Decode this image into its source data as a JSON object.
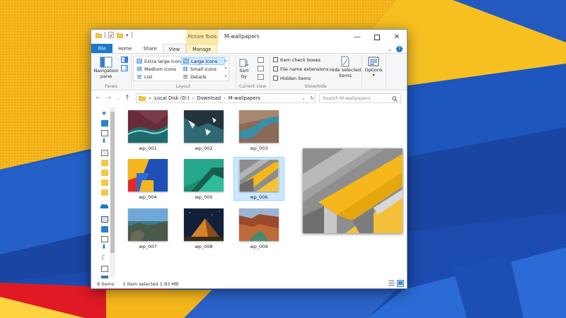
{
  "window": {
    "title": "M-wallpapers",
    "context_tab": "Picture Tools"
  },
  "tabs": [
    {
      "label": "File"
    },
    {
      "label": "Home"
    },
    {
      "label": "Share"
    },
    {
      "label": "View"
    },
    {
      "label": "Manage"
    }
  ],
  "ribbon": {
    "panes": {
      "nav_label": "Navigation pane",
      "nav_line1": "Navigation",
      "nav_line2": "pane",
      "group": "Panes"
    },
    "layout": {
      "items": [
        "Extra large icons",
        "Large icons",
        "Medium icons",
        "Small icons",
        "List",
        "Details"
      ],
      "selected": "Large icons",
      "group": "Layout"
    },
    "current_view": {
      "sort_line1": "Sort",
      "sort_line2": "by",
      "group": "Current view"
    },
    "show_hide": {
      "checkboxes": [
        "Item check boxes",
        "File name extensions",
        "Hidden items"
      ],
      "hide_line1": "Hide selected",
      "hide_line2": "items",
      "group": "Show/hide"
    },
    "options": {
      "label": "Options"
    }
  },
  "address": {
    "prefix": "«",
    "crumbs": [
      "Local Disk (D:)",
      "Download",
      "M-wallpapers"
    ]
  },
  "search": {
    "placeholder": "Search M-wallpapers"
  },
  "files": [
    {
      "name": "wp_001",
      "selected": false
    },
    {
      "name": "wp_002",
      "selected": false
    },
    {
      "name": "wp_003",
      "selected": false
    },
    {
      "name": "wp_004",
      "selected": false
    },
    {
      "name": "wp_005",
      "selected": false
    },
    {
      "name": "wp_006",
      "selected": true
    },
    {
      "name": "wp_007",
      "selected": false
    },
    {
      "name": "wp_008",
      "selected": false
    },
    {
      "name": "wp_009",
      "selected": false
    }
  ],
  "status": {
    "count": "9 items",
    "selection": "1 item selected  1.93 MB"
  },
  "colors": {
    "accent": "#1979ca",
    "selection": "#cce8ff",
    "desktop_yellow": "#f5b71c",
    "desktop_blue": "#1f54b9"
  }
}
